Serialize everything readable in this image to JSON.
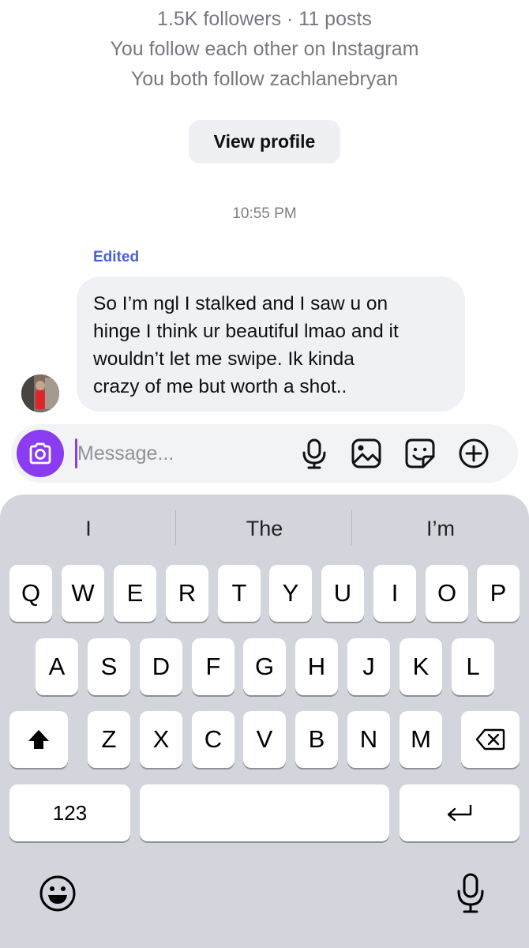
{
  "profile": {
    "stats": "1.5K followers · 11 posts",
    "mutual_follow": "You follow each other on Instagram",
    "shared_follow": "You both follow zachlanebryan",
    "view_profile_label": "View profile"
  },
  "thread": {
    "timestamp": "10:55 PM",
    "edited_label": "Edited",
    "message_lines": [
      "So I’m ngl I stalked and I saw u on",
      "hinge I think ur beautiful lmao and it",
      "wouldn’t let me swipe. Ik kinda",
      "crazy of me but worth a shot.."
    ]
  },
  "composer": {
    "placeholder": "Message...",
    "value": "",
    "accent_color": "#8b3cf0",
    "icons": [
      "camera-icon",
      "microphone-icon",
      "gallery-icon",
      "sticker-icon",
      "plus-icon"
    ]
  },
  "keyboard": {
    "suggestions": [
      "I",
      "The",
      "I’m"
    ],
    "row1": [
      "Q",
      "W",
      "E",
      "R",
      "T",
      "Y",
      "U",
      "I",
      "O",
      "P"
    ],
    "row2": [
      "A",
      "S",
      "D",
      "F",
      "G",
      "H",
      "J",
      "K",
      "L"
    ],
    "row3": [
      "Z",
      "X",
      "C",
      "V",
      "B",
      "N",
      "M"
    ],
    "numbers_label": "123",
    "space_label": "",
    "icons": [
      "shift-icon",
      "backspace-icon",
      "return-icon",
      "emoji-icon",
      "dictation-icon"
    ]
  }
}
